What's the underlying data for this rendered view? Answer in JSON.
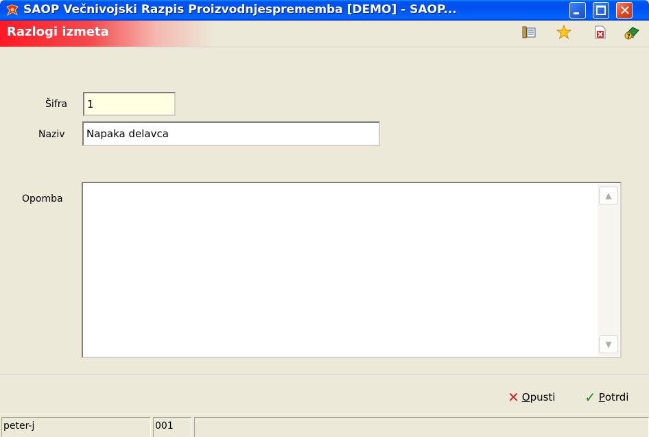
{
  "window": {
    "title": "SAOP Večnivojski Razpis Proizvodnjesprememba [DEMO] - SAOP...",
    "close_glyph": "✕"
  },
  "header": {
    "title": "Razlogi izmeta",
    "icons": [
      "list-settings-icon",
      "star-icon",
      "delete-record-icon",
      "help-book-icon"
    ]
  },
  "form": {
    "sifra_label": "Šifra",
    "sifra_value": "1",
    "naziv_label": "Naziv",
    "naziv_value": "Napaka delavca",
    "opomba_label": "Opomba",
    "opomba_value": ""
  },
  "actions": {
    "cancel_first": "O",
    "cancel_rest": "pusti",
    "confirm_first": "P",
    "confirm_rest": "otrdi"
  },
  "status": {
    "user": "peter-j",
    "code": "001",
    "extra": ""
  },
  "colors": {
    "titlebar_blue": "#0050ee",
    "header_red": "#ff1a24",
    "field_yellow": "#ffffe1"
  }
}
